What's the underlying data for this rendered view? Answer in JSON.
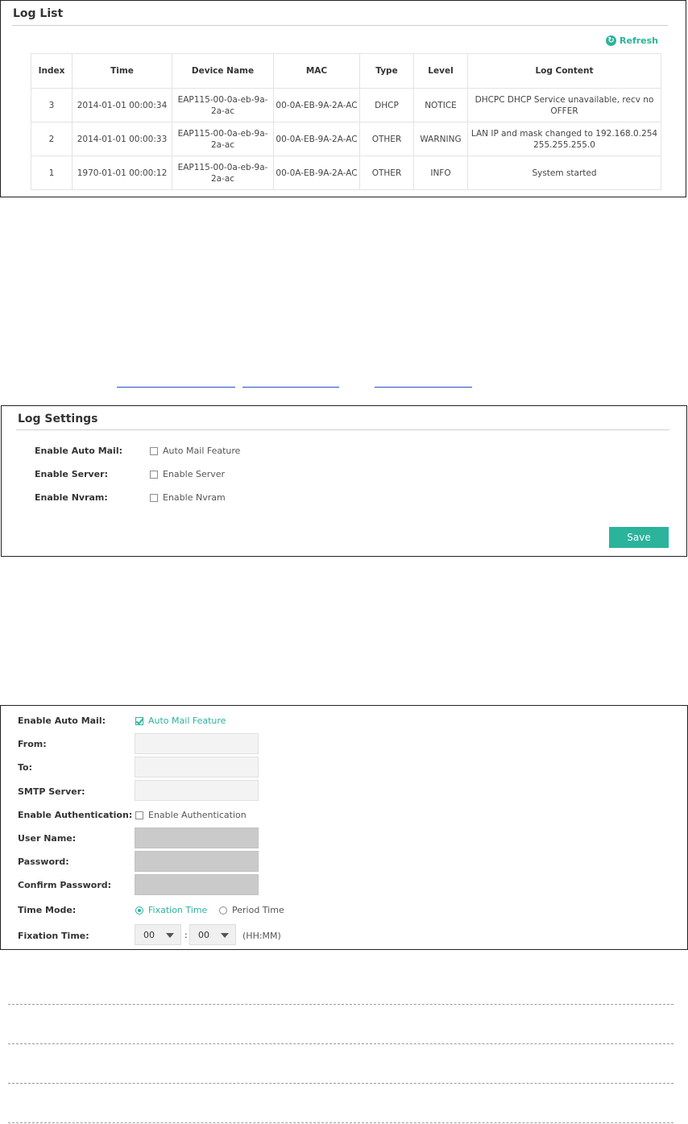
{
  "log_list": {
    "title": "Log List",
    "refresh_label": "Refresh",
    "columns": [
      "Index",
      "Time",
      "Device Name",
      "MAC",
      "Type",
      "Level",
      "Log Content"
    ],
    "rows": [
      {
        "index": "3",
        "time": "2014-01-01 00:00:34",
        "device": "EAP115-00-0a-eb-9a-2a-ac",
        "mac": "00-0A-EB-9A-2A-AC",
        "type": "DHCP",
        "level": "NOTICE",
        "content": "DHCPC DHCP Service unavailable, recv no OFFER"
      },
      {
        "index": "2",
        "time": "2014-01-01 00:00:33",
        "device": "EAP115-00-0a-eb-9a-2a-ac",
        "mac": "00-0A-EB-9A-2A-AC",
        "type": "OTHER",
        "level": "WARNING",
        "content": "LAN IP and mask changed to 192.168.0.254 255.255.255.0"
      },
      {
        "index": "1",
        "time": "1970-01-01 00:00:12",
        "device": "EAP115-00-0a-eb-9a-2a-ac",
        "mac": "00-0A-EB-9A-2A-AC",
        "type": "OTHER",
        "level": "INFO",
        "content": "System started"
      }
    ]
  },
  "log_settings": {
    "title": "Log Settings",
    "enable_auto_mail_label": "Enable Auto Mail:",
    "auto_mail_option": "Auto Mail Feature",
    "enable_server_label": "Enable Server:",
    "server_option": "Enable Server",
    "enable_nvram_label": "Enable Nvram:",
    "nvram_option": "Enable Nvram",
    "save_label": "Save"
  },
  "auto_mail": {
    "enable_auto_mail_label": "Enable Auto Mail:",
    "auto_mail_option": "Auto Mail Feature",
    "auto_mail_checked": true,
    "from_label": "From:",
    "to_label": "To:",
    "smtp_label": "SMTP Server:",
    "enable_auth_label": "Enable Authentication:",
    "auth_option": "Enable Authentication",
    "auth_checked": false,
    "username_label": "User Name:",
    "password_label": "Password:",
    "confirm_password_label": "Confirm Password:",
    "time_mode_label": "Time Mode:",
    "fixation_option": "Fixation Time",
    "period_option": "Period Time",
    "selected_time_mode": "Fixation Time",
    "fixation_time_label": "Fixation Time:",
    "hour_value": "00",
    "minute_value": "00",
    "separator": ":",
    "format_hint": "(HH:MM)"
  },
  "colors": {
    "accent": "#2bb39b",
    "link_underline": "#2a4fc8"
  },
  "icons": [
    "refresh-icon",
    "checkbox-icon",
    "radio-icon",
    "dropdown-caret-icon"
  ]
}
